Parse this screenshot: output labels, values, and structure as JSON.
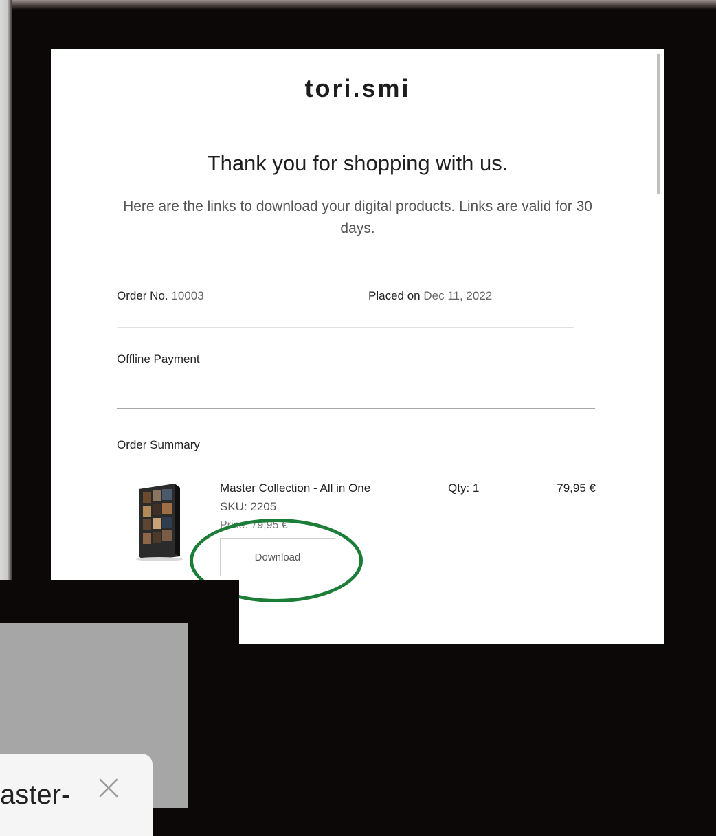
{
  "email": {
    "brand": "tori.smi",
    "thanks": "Thank you for shopping with us.",
    "intro": "Here are the links to download your digital products. Links are valid for 30 days.",
    "order_no_label": "Order No.",
    "order_no_value": "10003",
    "placed_on_label": "Placed on",
    "placed_on_value": "Dec 11, 2022",
    "payment_method": "Offline Payment",
    "summary_title": "Order Summary",
    "items": [
      {
        "name": "Master Collection - All in One",
        "sku": "SKU: 2205",
        "price": "Price: 79,95 €",
        "qty": "Qty: 1",
        "total": "79,95 €",
        "download_label": "Download"
      }
    ]
  },
  "overlay": {
    "partial_text": "aster-",
    "close_icon": "close-icon"
  },
  "colors": {
    "highlight": "#1c7d38",
    "background": "#0c0807"
  }
}
